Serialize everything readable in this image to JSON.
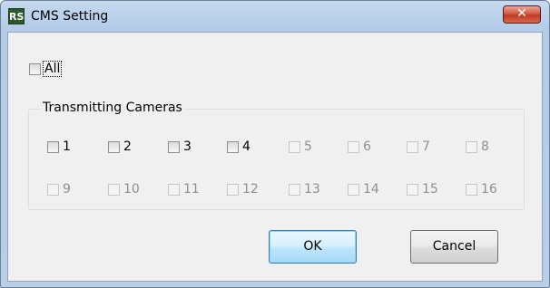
{
  "window": {
    "title": "CMS Setting",
    "icon_text": "RS",
    "close_glyph": "✕"
  },
  "all": {
    "label": "All",
    "checked": false
  },
  "group": {
    "title": "Transmitting Cameras",
    "cameras": [
      {
        "label": "1",
        "enabled": true
      },
      {
        "label": "2",
        "enabled": true
      },
      {
        "label": "3",
        "enabled": true
      },
      {
        "label": "4",
        "enabled": true
      },
      {
        "label": "5",
        "enabled": false
      },
      {
        "label": "6",
        "enabled": false
      },
      {
        "label": "7",
        "enabled": false
      },
      {
        "label": "8",
        "enabled": false
      },
      {
        "label": "9",
        "enabled": false
      },
      {
        "label": "10",
        "enabled": false
      },
      {
        "label": "11",
        "enabled": false
      },
      {
        "label": "12",
        "enabled": false
      },
      {
        "label": "13",
        "enabled": false
      },
      {
        "label": "14",
        "enabled": false
      },
      {
        "label": "15",
        "enabled": false
      },
      {
        "label": "16",
        "enabled": false
      }
    ]
  },
  "buttons": {
    "ok": "OK",
    "cancel": "Cancel"
  }
}
